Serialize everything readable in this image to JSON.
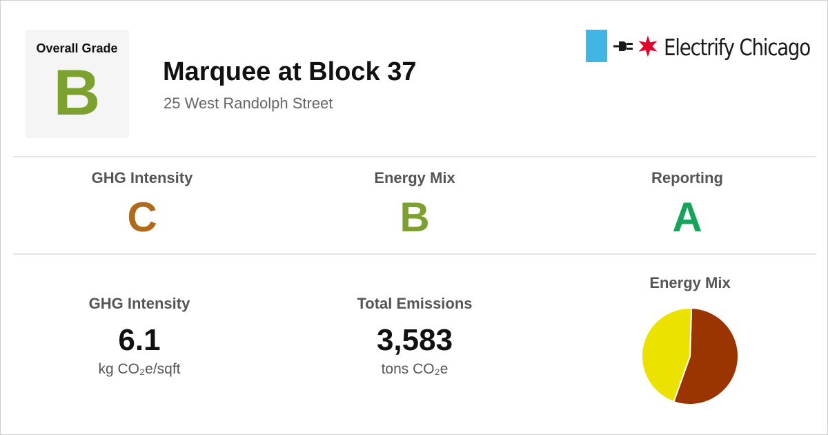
{
  "overall": {
    "label": "Overall Grade",
    "grade": "B",
    "grade_color": "#7ca12e"
  },
  "building": {
    "name": "Marquee at Block 37",
    "address": "25 West Randolph Street"
  },
  "logo": {
    "text": "Electrify Chicago",
    "block_color": "#41b6e6",
    "star_color": "#e4002b",
    "icons": [
      "plug-icon",
      "chicago-star-icon"
    ]
  },
  "grades": [
    {
      "label": "GHG Intensity",
      "grade": "C",
      "color": "#b06a1c"
    },
    {
      "label": "Energy Mix",
      "grade": "B",
      "color": "#7ca12e"
    },
    {
      "label": "Reporting",
      "grade": "A",
      "color": "#16a35a"
    }
  ],
  "metrics": {
    "ghg_intensity": {
      "label": "GHG Intensity",
      "value": "6.1",
      "unit": "kg CO₂e/sqft"
    },
    "total_emissions": {
      "label": "Total Emissions",
      "value": "3,583",
      "unit": "tons CO₂e"
    }
  },
  "energy_mix_chart": {
    "label": "Energy Mix",
    "chart_data": {
      "type": "pie",
      "values": [
        0.55,
        0.45
      ],
      "colors": [
        "#9a3400",
        "#ece200"
      ]
    }
  }
}
